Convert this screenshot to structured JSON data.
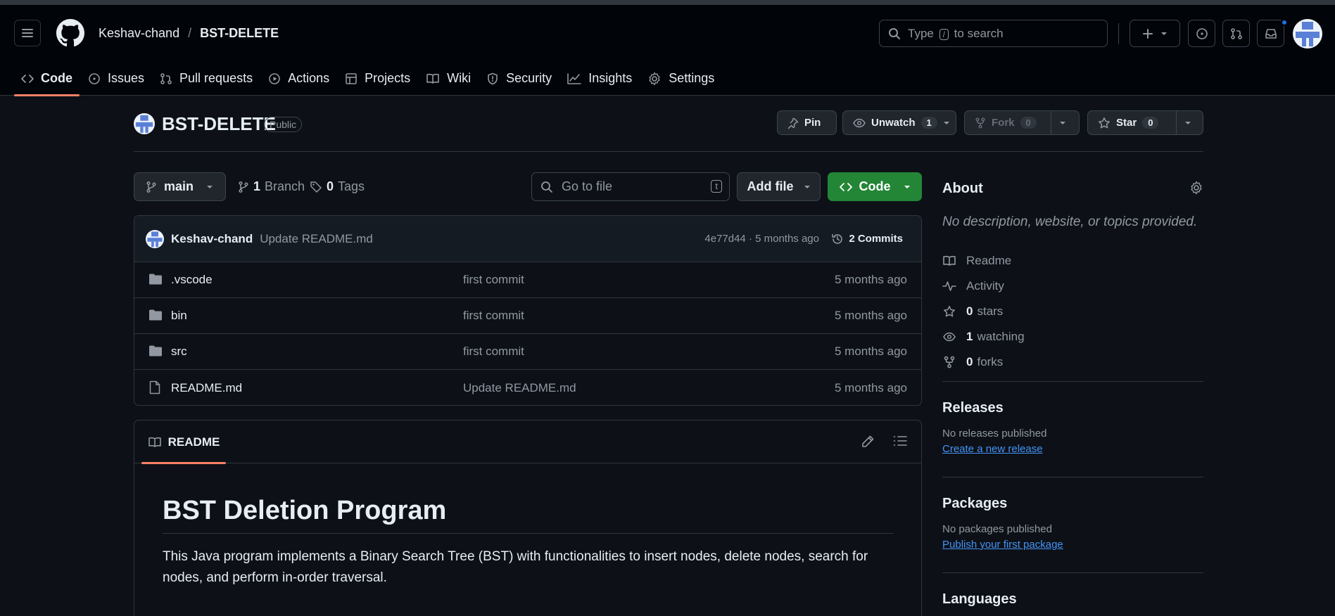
{
  "header": {
    "owner": "Keshav-chand",
    "separator": "/",
    "repo": "BST-DELETE",
    "search_prefix": "Type",
    "search_key": "/",
    "search_suffix": "to search"
  },
  "tabs": [
    {
      "label": "Code",
      "icon": "code-icon",
      "active": true
    },
    {
      "label": "Issues",
      "icon": "issue-icon"
    },
    {
      "label": "Pull requests",
      "icon": "pull-request-icon"
    },
    {
      "label": "Actions",
      "icon": "play-icon"
    },
    {
      "label": "Projects",
      "icon": "table-icon"
    },
    {
      "label": "Wiki",
      "icon": "book-icon"
    },
    {
      "label": "Security",
      "icon": "shield-icon"
    },
    {
      "label": "Insights",
      "icon": "graph-icon"
    },
    {
      "label": "Settings",
      "icon": "gear-icon"
    }
  ],
  "repo": {
    "title": "BST-DELETE",
    "visibility": "Public",
    "pin_label": "Pin",
    "unwatch_label": "Unwatch",
    "watch_count": "1",
    "fork_label": "Fork",
    "fork_count": "0",
    "star_label": "Star",
    "star_count": "0"
  },
  "filebar": {
    "branch": "main",
    "branch_count": "1",
    "branch_label": "Branch",
    "tag_count": "0",
    "tag_label": "Tags",
    "go_to_file_placeholder": "Go to file",
    "go_to_file_key": "t",
    "add_file_label": "Add file",
    "code_label": "Code"
  },
  "latest_commit": {
    "author": "Keshav-chand",
    "message": "Update README.md",
    "meta": "4e77d44 · 5 months ago",
    "commits_label": "2 Commits"
  },
  "files": [
    {
      "name": ".vscode",
      "type": "folder",
      "message": "first commit",
      "age": "5 months ago"
    },
    {
      "name": "bin",
      "type": "folder",
      "message": "first commit",
      "age": "5 months ago"
    },
    {
      "name": "src",
      "type": "folder",
      "message": "first commit",
      "age": "5 months ago"
    },
    {
      "name": "README.md",
      "type": "file",
      "message": "Update README.md",
      "age": "5 months ago"
    }
  ],
  "readme": {
    "tab_label": "README",
    "heading": "BST Deletion Program",
    "paragraph": "This Java program implements a Binary Search Tree (BST) with functionalities to insert nodes, delete nodes, search for nodes, and perform in-order traversal."
  },
  "about": {
    "title": "About",
    "description": "No description, website, or topics provided.",
    "readme_label": "Readme",
    "activity_label": "Activity",
    "stars_count": "0",
    "stars_label": "stars",
    "watching_count": "1",
    "watching_label": "watching",
    "forks_count": "0",
    "forks_label": "forks"
  },
  "releases": {
    "title": "Releases",
    "status": "No releases published",
    "link": "Create a new release"
  },
  "packages": {
    "title": "Packages",
    "status": "No packages published",
    "link": "Publish your first package"
  },
  "languages": {
    "title": "Languages"
  },
  "colors": {
    "background": "#0d1117",
    "header": "#010409",
    "accent_tab": "#f78166",
    "primary_button": "#238636",
    "link": "#4493f8",
    "notification": "#1f6feb"
  }
}
